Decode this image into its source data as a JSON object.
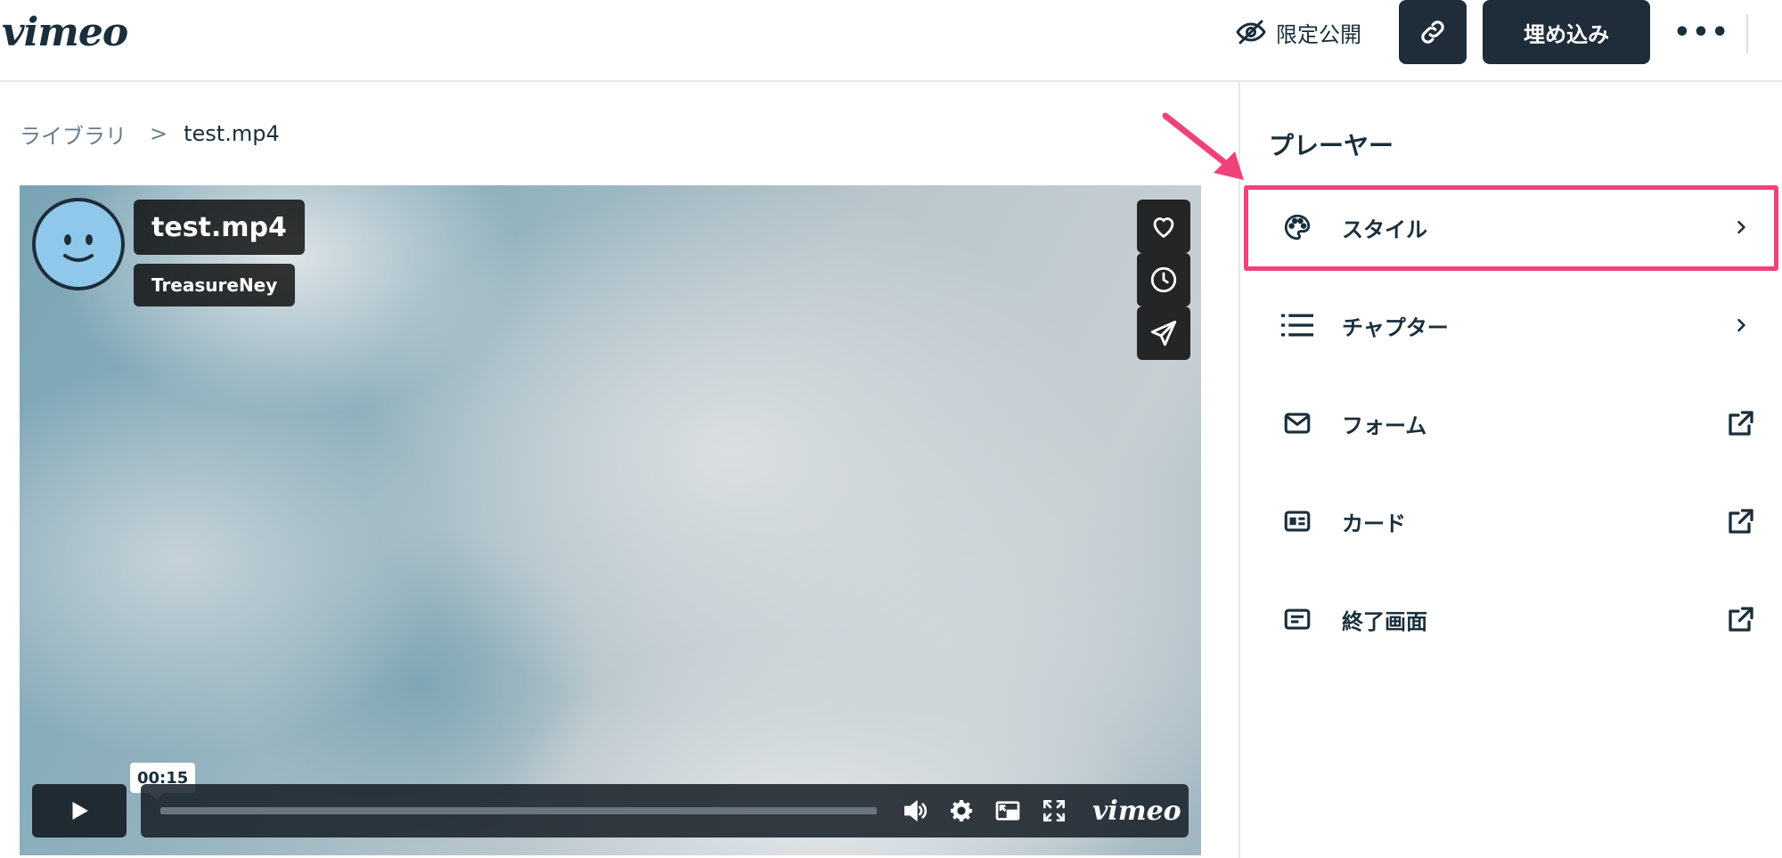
{
  "header": {
    "logo": "vimeo",
    "privacy_label": "限定公開",
    "embed_label": "埋め込み",
    "more_label": "•••"
  },
  "breadcrumb": {
    "library": "ライブラリ",
    "separator": ">",
    "current": "test.mp4"
  },
  "player": {
    "title": "test.mp4",
    "author": "TreasureNey",
    "time_tooltip": "00:15",
    "progress": 0.0,
    "bar_logo": "vimeo"
  },
  "panel": {
    "title": "プレーヤー",
    "items": [
      {
        "label": "スタイル",
        "icon": "palette-icon",
        "action": "chevron-right-icon"
      },
      {
        "label": "チャプター",
        "icon": "list-icon",
        "action": "chevron-right-icon"
      },
      {
        "label": "フォーム",
        "icon": "mail-icon",
        "action": "external-link-icon"
      },
      {
        "label": "カード",
        "icon": "card-icon",
        "action": "external-link-icon"
      },
      {
        "label": "終了画面",
        "icon": "end-screen-icon",
        "action": "external-link-icon"
      }
    ]
  },
  "colors": {
    "highlight": "#f0427a",
    "dark_button": "#1f2d3a",
    "text": "#1a2e3b"
  }
}
